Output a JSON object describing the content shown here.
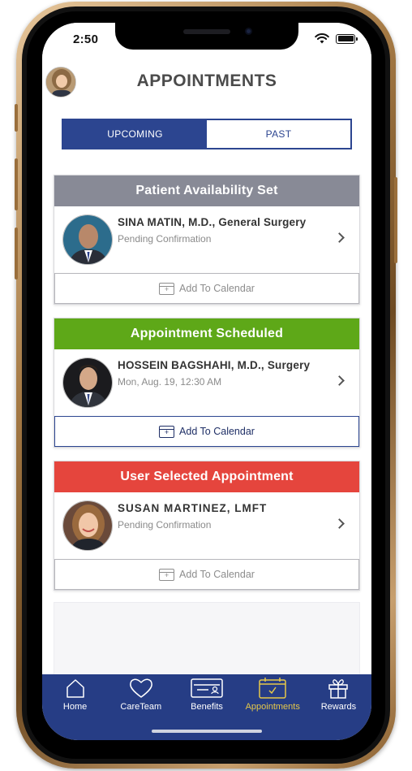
{
  "status_bar": {
    "time": "2:50"
  },
  "header": {
    "title": "APPOINTMENTS"
  },
  "segment": {
    "upcoming": "UPCOMING",
    "past": "PAST",
    "active": "upcoming"
  },
  "cards": [
    {
      "status": "Patient Availability Set",
      "status_color": "#888a96",
      "doctor": "SINA MATIN, M.D., General Surgery",
      "detail": "Pending Confirmation",
      "calendar_label": "Add To Calendar",
      "calendar_enabled": false
    },
    {
      "status": "Appointment Scheduled",
      "status_color": "#5ea818",
      "doctor": "HOSSEIN BAGSHAHI, M.D., Surgery",
      "detail": "Mon, Aug. 19, 12:30 AM",
      "calendar_label": "Add To Calendar",
      "calendar_enabled": true
    },
    {
      "status": "User Selected Appointment",
      "status_color": "#e5453d",
      "doctor": "SUSAN MARTINEZ, LMFT",
      "detail": "Pending Confirmation",
      "calendar_label": "Add To Calendar",
      "calendar_enabled": false
    }
  ],
  "tabbar": {
    "items": [
      {
        "label": "Home",
        "icon": "home-icon"
      },
      {
        "label": "CareTeam",
        "icon": "heart-icon"
      },
      {
        "label": "Benefits",
        "icon": "card-icon"
      },
      {
        "label": "Appointments",
        "icon": "calendar-check-icon"
      },
      {
        "label": "Rewards",
        "icon": "gift-icon"
      }
    ],
    "active": "Appointments"
  },
  "colors": {
    "primary": "#2c4590",
    "tabbar": "#263d85",
    "active_tab": "#e6c84a"
  }
}
